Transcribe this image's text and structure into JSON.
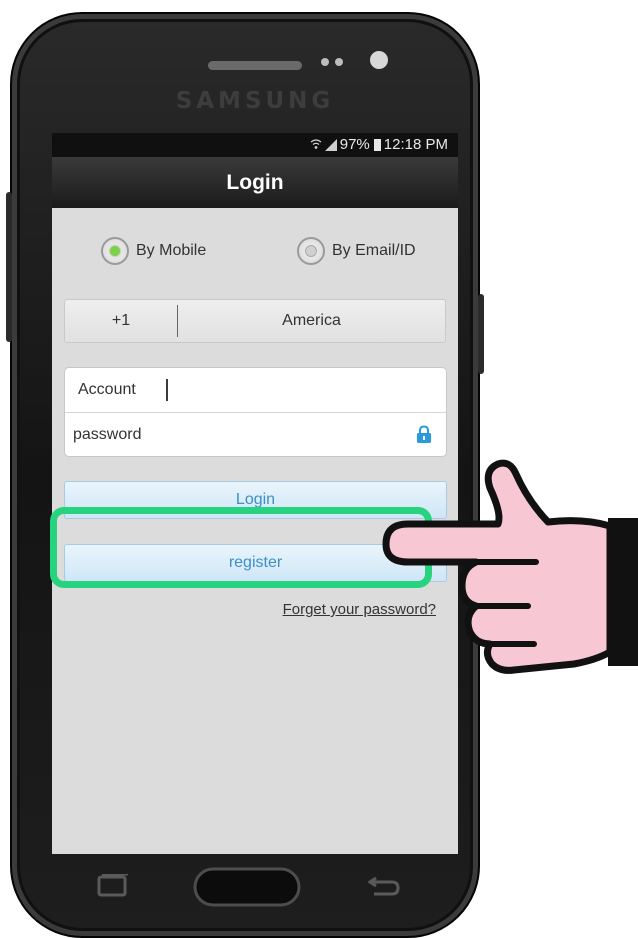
{
  "device": {
    "brand": "SAMSUNG"
  },
  "status_bar": {
    "battery": "97%",
    "time": "12:18 PM",
    "icons": [
      "wifi-icon",
      "signal-icon",
      "battery-icon"
    ]
  },
  "header": {
    "title": "Login"
  },
  "login_method": {
    "options": [
      {
        "label": "By Mobile",
        "selected": true
      },
      {
        "label": "By Email/ID",
        "selected": false
      }
    ],
    "selected_color": "#7ed04a"
  },
  "country": {
    "code": "+1",
    "name": "America"
  },
  "form": {
    "account_label": "Account",
    "password_placeholder": "password"
  },
  "buttons": {
    "login": "Login",
    "register": "register",
    "forgot_password": "Forget your password?"
  },
  "annotation": {
    "highlight_color": "#27d37e",
    "pointer": "pointing-hand-icon"
  },
  "colors": {
    "button_text": "#3c8fc9",
    "screen_bg": "#dcdcdc",
    "title_bar": "#1b1b1b"
  }
}
